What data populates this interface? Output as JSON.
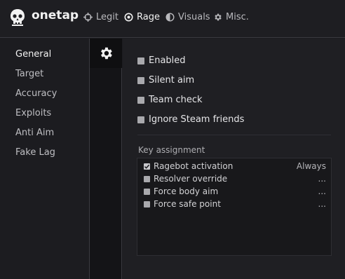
{
  "brand": "onetap",
  "tabs": [
    {
      "label": "Legit",
      "icon": "crosshair-icon"
    },
    {
      "label": "Rage",
      "icon": "target-icon"
    },
    {
      "label": "Visuals",
      "icon": "half-circle-icon"
    },
    {
      "label": "Misc.",
      "icon": "gear-icon"
    }
  ],
  "sidebar": {
    "items": [
      {
        "label": "General"
      },
      {
        "label": "Target"
      },
      {
        "label": "Accuracy"
      },
      {
        "label": "Exploits"
      },
      {
        "label": "Anti Aim"
      },
      {
        "label": "Fake Lag"
      }
    ]
  },
  "options": [
    {
      "label": "Enabled",
      "checked": false
    },
    {
      "label": "Silent aim",
      "checked": false
    },
    {
      "label": "Team check",
      "checked": false
    },
    {
      "label": "Ignore Steam friends",
      "checked": false
    }
  ],
  "key_assignment": {
    "title": "Key assignment",
    "rows": [
      {
        "label": "Ragebot activation",
        "value": "Always",
        "checked": true
      },
      {
        "label": "Resolver override",
        "value": "...",
        "checked": false
      },
      {
        "label": "Force body aim",
        "value": "...",
        "checked": false
      },
      {
        "label": "Force safe point",
        "value": "...",
        "checked": false
      }
    ]
  },
  "colors": {
    "background": "#1c1c20",
    "accent": "#f2f2f2"
  }
}
